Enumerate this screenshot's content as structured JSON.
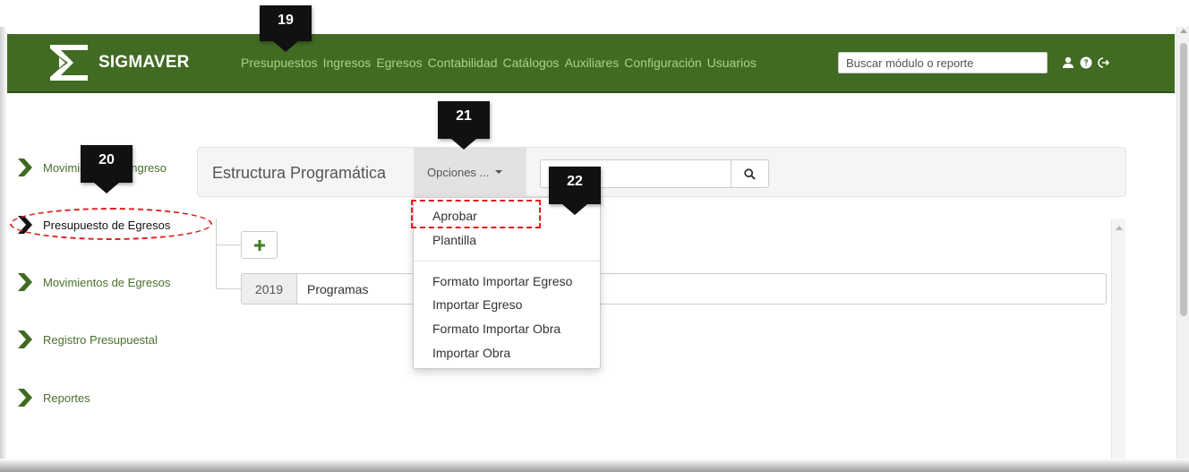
{
  "navbar": {
    "brand": "SIGMAVER",
    "menu": [
      "Presupuestos",
      "Ingresos",
      "Egresos",
      "Contabilidad",
      "Catálogos",
      "Auxiliares",
      "Configuración",
      "Usuarios"
    ],
    "search_placeholder": "Buscar módulo o reporte",
    "icons": [
      "user-icon",
      "help-icon",
      "logout-icon"
    ],
    "bg_color": "#416b23",
    "link_color": "#a6d480"
  },
  "sidebar": {
    "items": [
      {
        "label": "Movimientos de Ingreso"
      },
      {
        "label": "Presupuesto de Egresos"
      },
      {
        "label": "Movimientos de Egresos"
      },
      {
        "label": "Registro Presupuestal"
      },
      {
        "label": "Reportes"
      }
    ],
    "accent_color": "#3f6a21"
  },
  "toolbar": {
    "title": "Estructura Programática",
    "options_label": "Opciones ..."
  },
  "options_menu": {
    "items": [
      "Aprobar",
      "Plantilla",
      "Formato Importar Egreso",
      "Importar Egreso",
      "Formato Importar Obra",
      "Importar Obra"
    ]
  },
  "tree": {
    "year": "2019",
    "program": "Programas"
  },
  "callouts": [
    "19",
    "20",
    "21",
    "22"
  ],
  "highlight_color": "#e01f1f"
}
